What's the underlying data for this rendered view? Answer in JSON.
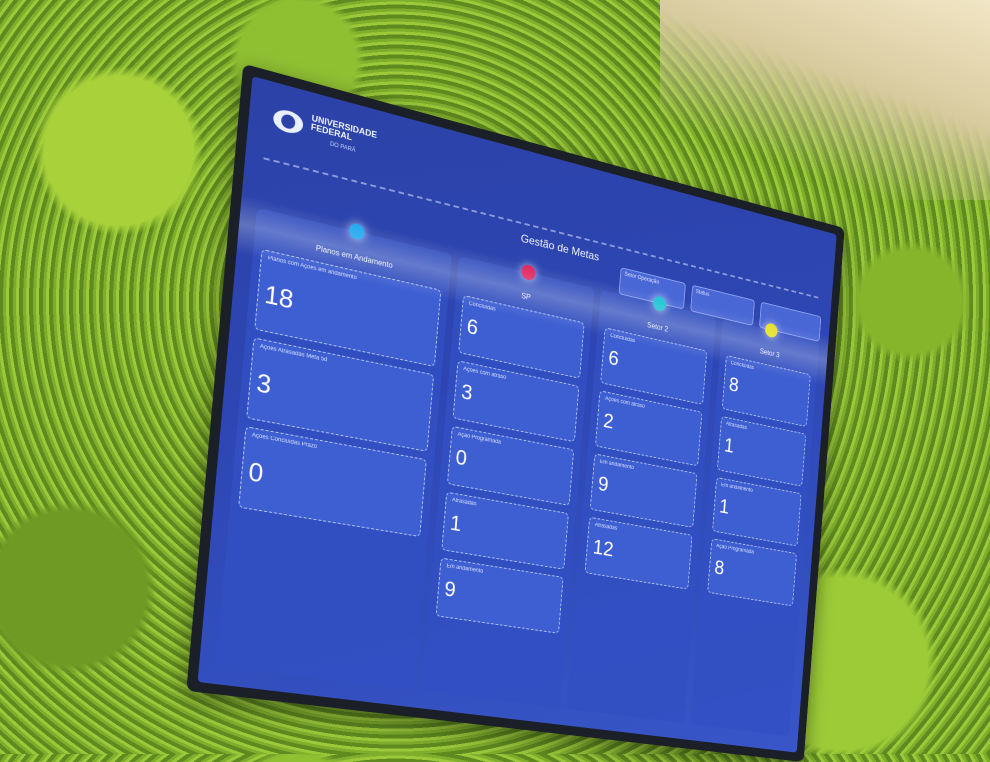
{
  "header": {
    "logo_line1": "UNIVERSIDADE",
    "logo_line2": "FEDERAL",
    "logo_sub": "DO PARÁ",
    "title": "Gestão de Metas"
  },
  "top_cards": [
    {
      "label": "Setor Operação"
    },
    {
      "label": "Status"
    },
    {
      "label": ""
    }
  ],
  "columns": [
    {
      "title": "Planos em Andamento",
      "dot_color": "#1ea8f0",
      "cards": [
        {
          "label": "Planos com Ações em andamento",
          "value": "18"
        },
        {
          "label": "Ações Atrasadas Meta 5d",
          "value": "3"
        },
        {
          "label": "Ações Concluídas Prazo",
          "value": "0"
        }
      ]
    },
    {
      "title": "SP",
      "dot_color": "#e0245e",
      "cards": [
        {
          "label": "Concluídas",
          "value": "6"
        },
        {
          "label": "Ações com atraso",
          "value": "3"
        },
        {
          "label": "Ação Programada",
          "value": "0"
        },
        {
          "label": "Atrasadas",
          "value": "1"
        },
        {
          "label": "Em andamento",
          "value": "9"
        }
      ]
    },
    {
      "title": "Setor 2",
      "dot_color": "#1fc3d6",
      "cards": [
        {
          "label": "Concluídas",
          "value": "6"
        },
        {
          "label": "Ações com atraso",
          "value": "2"
        },
        {
          "label": "Em andamento",
          "value": "9"
        },
        {
          "label": "Atrasadas",
          "value": "12"
        }
      ]
    },
    {
      "title": "Setor 3",
      "dot_color": "#e6e02a",
      "cards": [
        {
          "label": "Concluídas",
          "value": "8"
        },
        {
          "label": "Atrasadas",
          "value": "1"
        },
        {
          "label": "Em andamento",
          "value": "1"
        },
        {
          "label": "Ação Programada",
          "value": "8"
        }
      ]
    }
  ]
}
